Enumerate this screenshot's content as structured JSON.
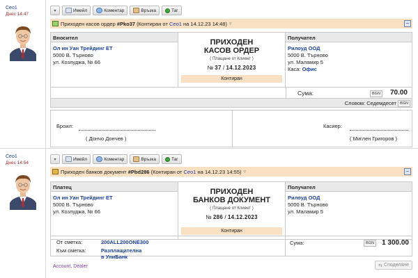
{
  "entries": [
    {
      "author": "Ceo1",
      "date": "Днес 14:47",
      "toolbar": {
        "email": "Имейл",
        "comment": "Коментар",
        "link": "Връзка",
        "tag": "Таг"
      },
      "doc_header": {
        "prefix": "Приходен касов ордер",
        "number": "#Pko37",
        "paren_open": "(Контиран от",
        "user": "Ceo1",
        "rest": "на 14.12.23 14:48)"
      },
      "left_col": {
        "header": "Вносител",
        "name": "Ол ин Уан Трейдинг ЕТ",
        "line1": "5000 В. Търново",
        "line2": "ул. Козлуджа, № 66"
      },
      "middle": {
        "title1": "ПРИХОДЕН",
        "title2": "КАСОВ ОРДЕР",
        "sub": "( Плащане от Клиент )",
        "num_prefix": "№",
        "num": "37",
        "sep": "/",
        "date": "14.12.2023",
        "status": "Контиран"
      },
      "right_col": {
        "header": "Получател",
        "name": "Рилоуд ООД",
        "line1": "5000 В. Търново",
        "line2": "ул. Маламир 5",
        "kasa_label": "Каса:",
        "kasa_value": "Офис"
      },
      "sum": {
        "label": "Сума:",
        "currency": "BGN",
        "value": "70.00"
      },
      "words": {
        "text": "Словом: Седемдесет",
        "currency": "BGN"
      },
      "signatures": {
        "left_label": "Броил:",
        "left_name": "( Дончо Дончев )",
        "right_label": "Касиер:",
        "right_name": "( Миглен Григоров )"
      }
    },
    {
      "author": "Ceo1",
      "date": "Днес 14:54",
      "toolbar": {
        "email": "Имейл",
        "comment": "Коментар",
        "link": "Връзка",
        "tag": "Таг"
      },
      "doc_header": {
        "prefix": "Приходен банков документ",
        "number": "#Pbd286",
        "paren_open": "(Контиран от",
        "user": "Ceo1",
        "rest": "на 14.12.23 14:55)"
      },
      "left_col": {
        "header": "Платец",
        "name": "Ол ин Уан Трейдинг ЕТ",
        "line1": "5000 В. Търново",
        "line2": "ул. Козлуджа, № 66"
      },
      "middle": {
        "title1": "ПРИХОДЕН",
        "title2": "БАНКОВ ДОКУМЕНТ",
        "sub": "( Плащане от Клиент )",
        "num_prefix": "№",
        "num": "286",
        "sep": "/",
        "date": "14.12.2023",
        "status": "Контиран"
      },
      "right_col": {
        "header": "Получател",
        "name": "Рилоуд ООД",
        "line1": "5000 В. Търново",
        "line2": "ул. Маламир 5"
      },
      "accounts": {
        "from_label": "От сметка:",
        "from_value": "200ALL200ONE300",
        "to_label": "Към сметка:",
        "to_value": "Разплащателна в УниБанк"
      },
      "sum": {
        "label": "Сума:",
        "currency": "BGN",
        "value": "1 300.00"
      },
      "footer": {
        "account": "Account",
        "sep": ",",
        "dealer": "Dealer"
      },
      "share_label": "Споделяне"
    }
  ],
  "colors": {
    "accent_link": "#1a3fa0",
    "date_red": "#b0242a",
    "doc_bar": "#f9e0c2",
    "header_grey": "#e9e9e9",
    "tag_green": "#3aa53a"
  }
}
